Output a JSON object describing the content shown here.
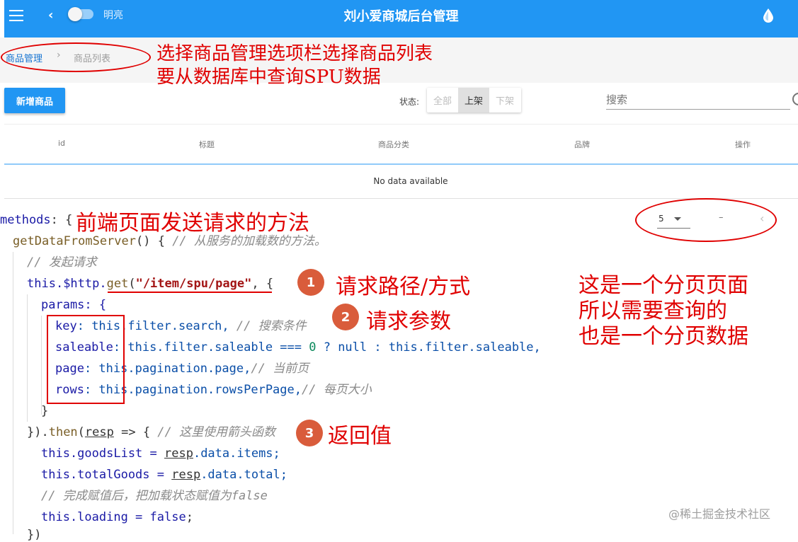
{
  "appbar": {
    "title": "刘小爱商城后台管理",
    "toggle_label": "明亮",
    "icons": [
      "menu-icon",
      "back-icon",
      "theme-drop-icon"
    ],
    "color": "#2196f3"
  },
  "breadcrumb": {
    "items": [
      "商品管理",
      "商品列表"
    ],
    "separator": "›"
  },
  "toolbar": {
    "new_button": "新增商品",
    "status_label": "状态:",
    "status_options": [
      "全部",
      "上架",
      "下架"
    ],
    "status_selected": "上架",
    "search_placeholder": "搜索"
  },
  "table": {
    "headers": [
      "id",
      "标题",
      "商品分类",
      "品牌",
      "操作"
    ],
    "empty_text": "No data available"
  },
  "pagination": {
    "rows_per_page": "5",
    "page_info": "–"
  },
  "code": {
    "l1_kw": "methods",
    "l1_rest": ": {",
    "l2_fn": "getDataFromServer",
    "l2_rest": "() { ",
    "l2_cm": "// 从服务的加载数的方法。",
    "l3_cm": "// 发起请求",
    "l4_this": "this",
    "l4_http": ".$http.",
    "l4_get": "get",
    "l4_paren": "(",
    "l4_str": "\"/item/spu/page\"",
    "l4_rest": ", {",
    "l5": "params: {",
    "l6_key": "key",
    "l6_rest": ": this.filter.search, ",
    "l6_cm": "// 搜索条件",
    "l7_key": "saleable",
    "l7_rest": ": this.filter.saleable === ",
    "l7_num": "0",
    "l7_rest2": " ? null : this.filter.saleable,",
    "l8_key": "page",
    "l8_rest": ": this.pagination.page,",
    "l8_cm": "// 当前页",
    "l9_key": "rows",
    "l9_rest": ": this.pagination.rowsPerPage,",
    "l9_cm": "// 每页大小",
    "l10": "}",
    "l11_a": "}).",
    "l11_then": "then",
    "l11_b": "(",
    "l11_resp": "resp",
    "l11_c": " => { ",
    "l11_cm": "// 这里使用箭头函数",
    "l12_a": "this.goodsList = ",
    "l12_resp": "resp",
    "l12_b": ".data.items;",
    "l13_a": "this.totalGoods = ",
    "l13_resp": "resp",
    "l13_b": ".data.total;",
    "l14_cm": "// 完成赋值后，把加载状态赋值为false",
    "l15_a": "this.loading = ",
    "l15_kw": "false",
    "l15_b": ";",
    "l16": "})"
  },
  "annotations": {
    "top_1": "选择商品管理选项栏选择商品列表",
    "top_2": "要从数据库中查询SPU数据",
    "methods_note": "前端页面发送请求的方法",
    "badge_1": "1",
    "badge_1_text": "请求路径/方式",
    "badge_2": "2",
    "badge_2_text": "请求参数",
    "badge_3": "3",
    "badge_3_text": "返回值",
    "right_1": "这是一个分页页面",
    "right_2": "所以需要查询的",
    "right_3": "也是一个分页数据",
    "color": "#e00000"
  },
  "watermark": "@稀土掘金技术社区"
}
